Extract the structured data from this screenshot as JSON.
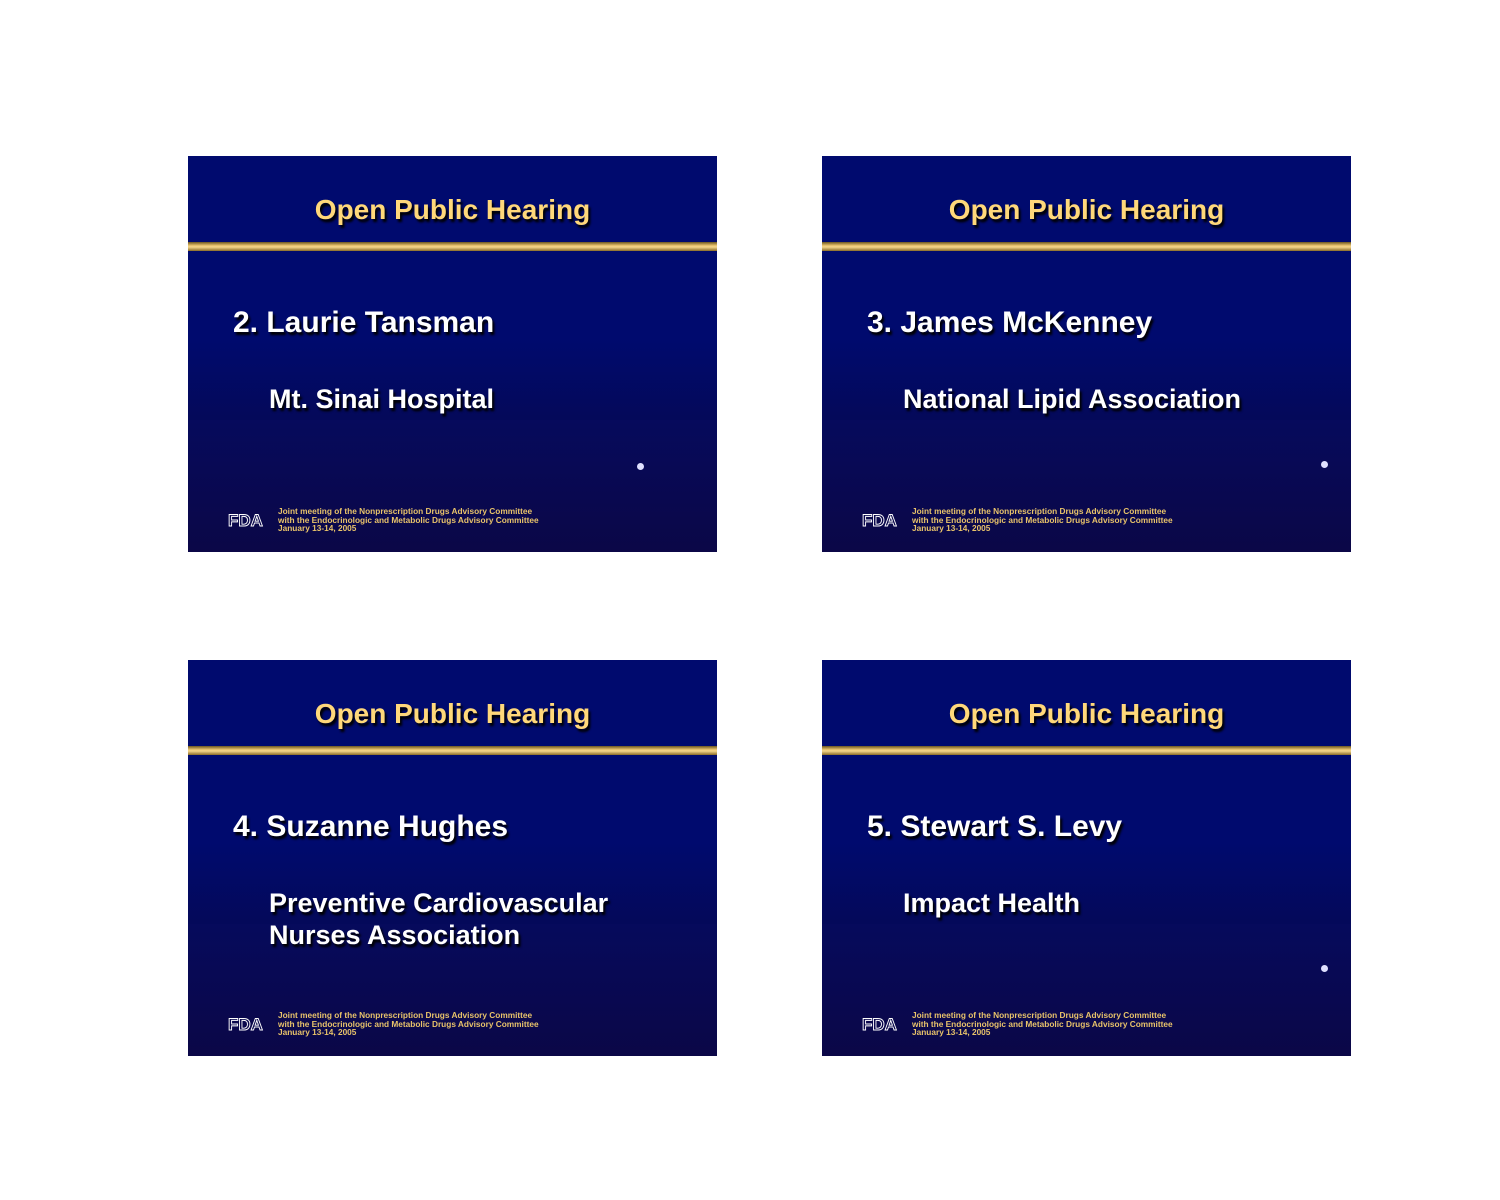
{
  "slides": [
    {
      "title": "Open Public Hearing",
      "name": "2. Laurie Tansman",
      "org_lines": [
        "Mt. Sinai Hospital"
      ],
      "logo_text": "FDA",
      "footer_lines": [
        "Joint meeting of the Nonprescription Drugs Advisory Committee",
        "with the Endocrinologic and Metabolic Drugs Advisory Committee",
        "January 13-14, 2005"
      ]
    },
    {
      "title": "Open Public Hearing",
      "name": "3. James McKenney",
      "org_lines": [
        "National Lipid Association"
      ],
      "logo_text": "FDA",
      "footer_lines": [
        "Joint meeting of the Nonprescription Drugs Advisory Committee",
        "with the Endocrinologic and Metabolic Drugs Advisory Committee",
        "January 13-14, 2005"
      ]
    },
    {
      "title": "Open Public Hearing",
      "name": "4. Suzanne Hughes",
      "org_lines": [
        "Preventive Cardiovascular",
        "Nurses Association"
      ],
      "logo_text": "FDA",
      "footer_lines": [
        "Joint meeting of the Nonprescription Drugs Advisory Committee",
        "with the Endocrinologic and Metabolic Drugs Advisory Committee",
        "January 13-14, 2005"
      ]
    },
    {
      "title": "Open Public Hearing",
      "name": "5. Stewart S. Levy",
      "org_lines": [
        "Impact Health"
      ],
      "logo_text": "FDA",
      "footer_lines": [
        "Joint meeting of the Nonprescription Drugs Advisory Committee",
        "with the Endocrinologic and Metabolic Drugs Advisory Committee",
        "January 13-14, 2005"
      ]
    }
  ]
}
